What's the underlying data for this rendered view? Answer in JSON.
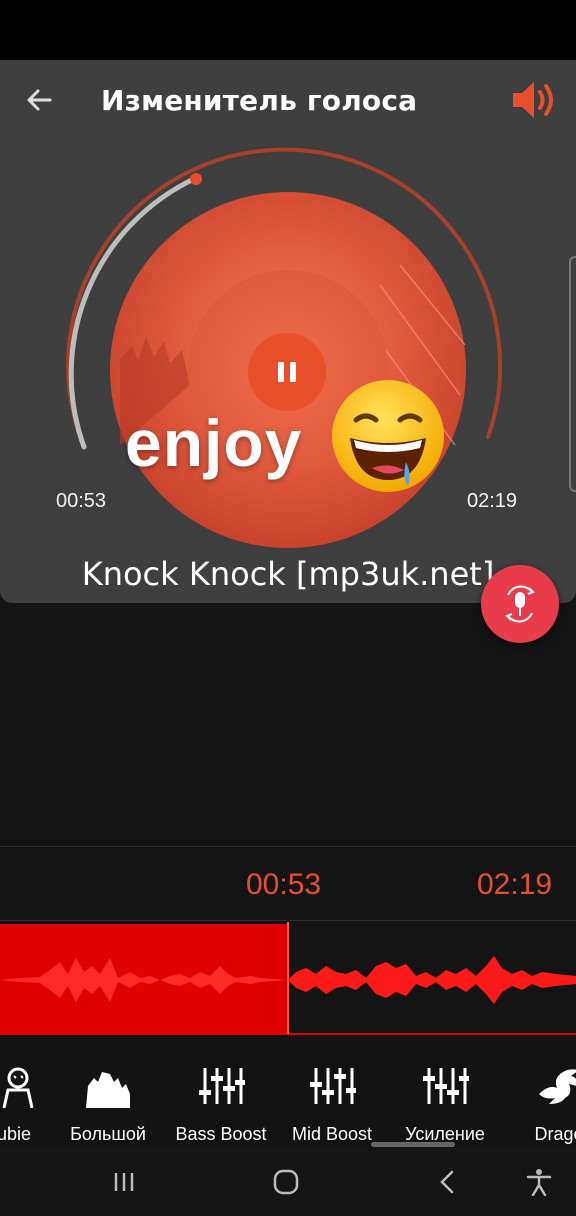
{
  "header": {
    "title": "Изменитель голоса",
    "back_icon": "arrow-left-icon",
    "speaker_icon": "volume-icon",
    "accent": "#e8502c"
  },
  "player": {
    "time_current": "00:53",
    "time_total": "02:19",
    "progress": 0.38,
    "song_title": "Knock Knock [mp3uk.net]",
    "overlay_text": "enjoy",
    "overlay_emoji": "grinning-sweat-emoji",
    "state": "playing"
  },
  "waveform": {
    "time_current": "00:53",
    "time_total": "02:19",
    "played_color": "#ff0000"
  },
  "effects": [
    {
      "label": "ubie",
      "icon": "zombie-icon"
    },
    {
      "label": "Большой",
      "icon": "monster-icon"
    },
    {
      "label": "Bass Boost",
      "icon": "equalizer-icon"
    },
    {
      "label": "Mid Boost",
      "icon": "equalizer-icon"
    },
    {
      "label": "Усиление",
      "icon": "equalizer-icon"
    },
    {
      "label": "Drago",
      "icon": "dragon-icon"
    }
  ],
  "navigation": {
    "recent": "recent-apps-icon",
    "home": "home-icon",
    "back": "back-icon",
    "accessibility": "accessibility-icon"
  }
}
